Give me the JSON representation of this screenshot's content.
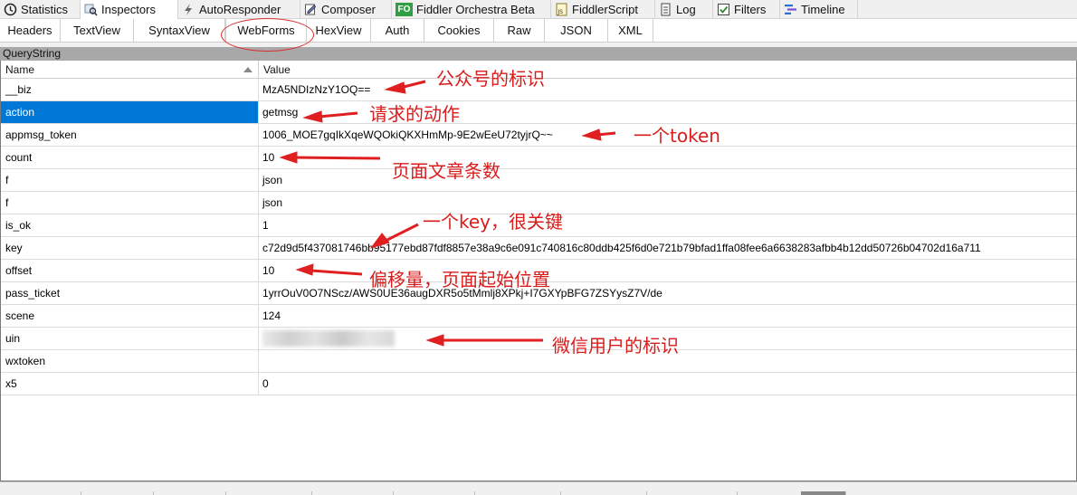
{
  "top_tabs": [
    {
      "label": "Statistics",
      "icon": "clock-icon"
    },
    {
      "label": "Inspectors",
      "icon": "inspect-icon"
    },
    {
      "label": "AutoResponder",
      "icon": "lightning-icon"
    },
    {
      "label": "Composer",
      "icon": "pencil-icon"
    },
    {
      "label": "Fiddler Orchestra Beta",
      "icon": "fo-badge-icon"
    },
    {
      "label": "FiddlerScript",
      "icon": "js-script-icon"
    },
    {
      "label": "Log",
      "icon": "document-icon"
    },
    {
      "label": "Filters",
      "icon": "checkbox-icon"
    },
    {
      "label": "Timeline",
      "icon": "timeline-icon"
    }
  ],
  "sub_tabs": [
    "Headers",
    "TextView",
    "SyntaxView",
    "WebForms",
    "HexView",
    "Auth",
    "Cookies",
    "Raw",
    "JSON",
    "XML"
  ],
  "section_title": "QueryString",
  "columns": {
    "name": "Name",
    "value": "Value"
  },
  "rows": [
    {
      "name": "__biz",
      "value": "MzA5NDIzNzY1OQ=="
    },
    {
      "name": "action",
      "value": "getmsg"
    },
    {
      "name": "appmsg_token",
      "value": "1006_MOE7gqIkXqeWQOkiQKXHmMp-9E2wEeU72tyjrQ~~"
    },
    {
      "name": "count",
      "value": "10"
    },
    {
      "name": "f",
      "value": "json"
    },
    {
      "name": "f",
      "value": "json"
    },
    {
      "name": "is_ok",
      "value": "1"
    },
    {
      "name": "key",
      "value": "c72d9d5f437081746bb95177ebd87fdf8857e38a9c6e091c740816c80ddb425f6d0e721b79bfad1ffa08fee6a6638283afbb4b12dd50726b04702d16a711"
    },
    {
      "name": "offset",
      "value": "10"
    },
    {
      "name": "pass_ticket",
      "value": "1yrrOuV0O7NScz/AWS0UE36augDXR5o5tMmlj8XPkj+I7GXYpBFG7ZSYysZ7V/de"
    },
    {
      "name": "scene",
      "value": "124"
    },
    {
      "name": "uin",
      "value": ""
    },
    {
      "name": "wxtoken",
      "value": ""
    },
    {
      "name": "x5",
      "value": "0"
    }
  ],
  "annotations": {
    "biz": "公众号的标识",
    "action": "请求的动作",
    "token": "一个token",
    "count": "页面文章条数",
    "key": "一个key，很关键",
    "offset": "偏移量，页面起始位置",
    "uin": "微信用户的标识"
  },
  "colors": {
    "selected_row": "#0078d7",
    "annotation": "#d91c1c",
    "section_bar": "#a8a8a8"
  }
}
